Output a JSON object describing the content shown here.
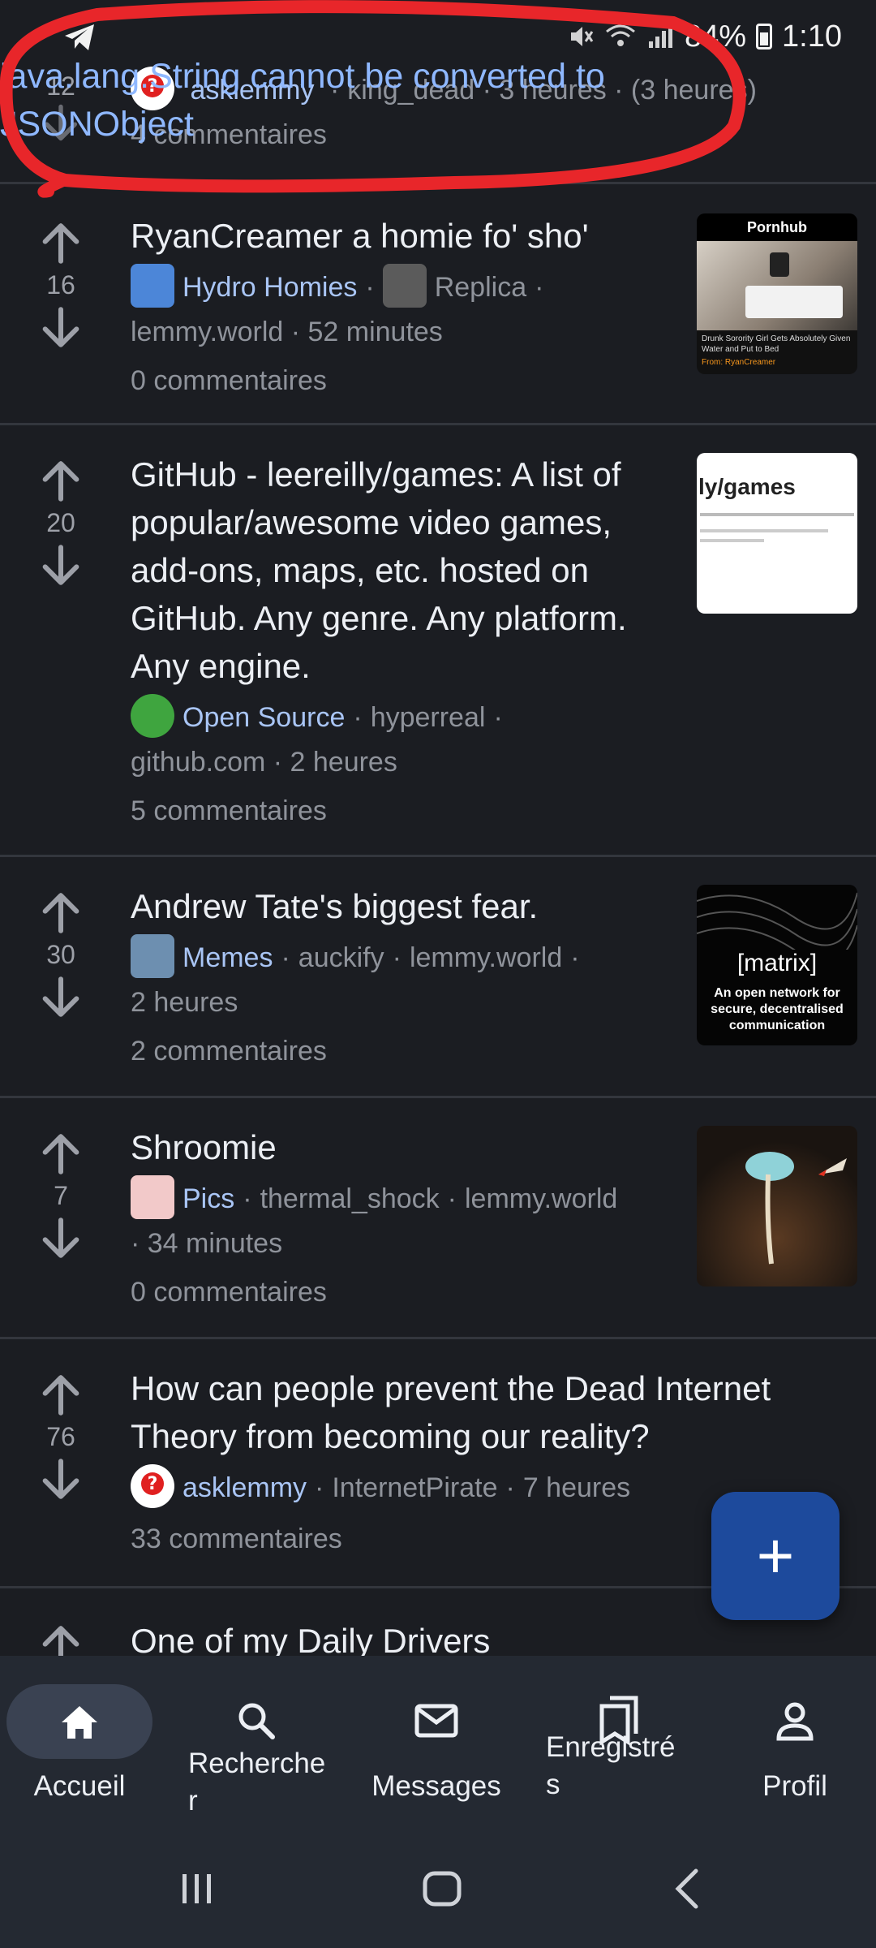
{
  "status_bar": {
    "battery": "84%",
    "time": "1:10"
  },
  "error_banner": {
    "line1": "java.lang.String cannot be converted to",
    "line2": "JSONObject"
  },
  "top_post": {
    "score": "12",
    "community": "asklemmy",
    "meta_rest": "king_dead · 3 heures · (3 heures)",
    "comments": "4 commentaires"
  },
  "posts": [
    {
      "score": "16",
      "title": "RyanCreamer a homie fo' sho'",
      "community": "Hydro Homies",
      "author": "Replica",
      "meta_line2": "lemmy.world · 52 minutes",
      "comments": "0 commentaires",
      "thumb_header": "Pornhub",
      "thumb_caption": "Drunk Sorority Girl Gets Absolutely Given Water and Put to Bed",
      "thumb_from": "From: RyanCreamer"
    },
    {
      "score": "20",
      "title_lines": [
        "GitHub - leereilly/games: A list of",
        "popular/awesome video games,",
        "add-ons, maps, etc. hosted on",
        "GitHub. Any genre. Any platform.",
        "Any engine."
      ],
      "community": "Open Source",
      "author": "hyperreal",
      "meta_line2": "github.com · 2 heures",
      "comments": "5 commentaires",
      "thumb_title": "ly/games"
    },
    {
      "score": "30",
      "title": "Andrew Tate's biggest fear.",
      "community": "Memes",
      "author": "auckify",
      "instance": "lemmy.world",
      "meta_line2": "2 heures",
      "comments": "2 commentaires",
      "thumb_brand": "[matrix]",
      "thumb_caption": "An open network for secure, decentralised communication"
    },
    {
      "score": "7",
      "title": "Shroomie",
      "community": "Pics",
      "author": "thermal_shock",
      "instance": "lemmy.world",
      "meta_line2": "· 34 minutes",
      "comments": "0 commentaires"
    },
    {
      "score": "76",
      "title_lines": [
        "How can people prevent the Dead Internet",
        "Theory from becoming our reality?"
      ],
      "community": "asklemmy",
      "author": "InternetPirate",
      "time": "7 heures",
      "comments": "33 commentaires"
    },
    {
      "title": "One of my Daily Drivers"
    }
  ],
  "fab": {
    "label": "+"
  },
  "bottom_nav": [
    {
      "label": "Accueil"
    },
    {
      "label_lines": [
        "Recherche",
        "r"
      ]
    },
    {
      "label": "Messages"
    },
    {
      "label_lines": [
        "Enregistré",
        "s"
      ]
    },
    {
      "label": "Profil"
    }
  ],
  "colors": {
    "background": "#1b1d22",
    "community_link": "#a9c5f5",
    "fab": "#1d4a9c",
    "nav_bar": "#242932",
    "annotation": "#e8262a"
  }
}
